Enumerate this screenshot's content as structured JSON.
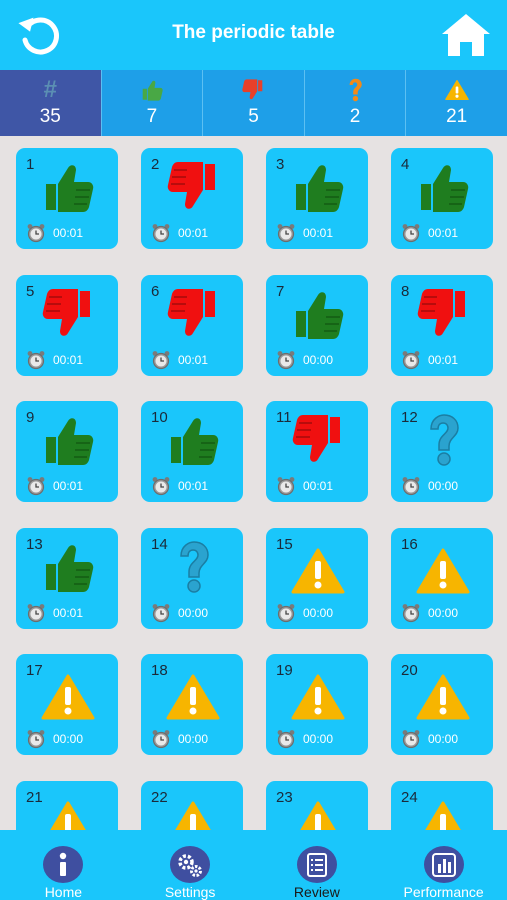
{
  "header": {
    "title": "The periodic table",
    "back_icon": "refresh-back-icon",
    "home_icon": "home-icon"
  },
  "stats": [
    {
      "icon": "hash-icon",
      "symbol": "#",
      "value": "35"
    },
    {
      "icon": "thumbs-up-icon",
      "value": "7"
    },
    {
      "icon": "thumbs-down-icon",
      "value": "5"
    },
    {
      "icon": "question-icon",
      "value": "2"
    },
    {
      "icon": "warning-icon",
      "value": "21"
    }
  ],
  "tiles": [
    {
      "number": "1",
      "status": "correct",
      "time": "00:01"
    },
    {
      "number": "2",
      "status": "wrong",
      "time": "00:01"
    },
    {
      "number": "3",
      "status": "correct",
      "time": "00:01"
    },
    {
      "number": "4",
      "status": "correct",
      "time": "00:01"
    },
    {
      "number": "5",
      "status": "wrong",
      "time": "00:01"
    },
    {
      "number": "6",
      "status": "wrong",
      "time": "00:01"
    },
    {
      "number": "7",
      "status": "correct",
      "time": "00:00"
    },
    {
      "number": "8",
      "status": "wrong",
      "time": "00:01"
    },
    {
      "number": "9",
      "status": "correct",
      "time": "00:01"
    },
    {
      "number": "10",
      "status": "correct",
      "time": "00:01"
    },
    {
      "number": "11",
      "status": "wrong",
      "time": "00:01"
    },
    {
      "number": "12",
      "status": "unsure",
      "time": "00:00"
    },
    {
      "number": "13",
      "status": "correct",
      "time": "00:01"
    },
    {
      "number": "14",
      "status": "unsure",
      "time": "00:00"
    },
    {
      "number": "15",
      "status": "unanswered",
      "time": "00:00"
    },
    {
      "number": "16",
      "status": "unanswered",
      "time": "00:00"
    },
    {
      "number": "17",
      "status": "unanswered",
      "time": "00:00"
    },
    {
      "number": "18",
      "status": "unanswered",
      "time": "00:00"
    },
    {
      "number": "19",
      "status": "unanswered",
      "time": "00:00"
    },
    {
      "number": "20",
      "status": "unanswered",
      "time": "00:00"
    },
    {
      "number": "21",
      "status": "unanswered",
      "time": ""
    },
    {
      "number": "22",
      "status": "unanswered",
      "time": ""
    },
    {
      "number": "23",
      "status": "unanswered",
      "time": ""
    },
    {
      "number": "24",
      "status": "unanswered",
      "time": ""
    }
  ],
  "tabs": [
    {
      "label": "Home",
      "icon": "info-icon"
    },
    {
      "label": "Settings",
      "icon": "gears-icon"
    },
    {
      "label": "Review",
      "icon": "list-icon",
      "active": true
    },
    {
      "label": "Performance",
      "icon": "bar-chart-icon"
    }
  ],
  "colors": {
    "primary": "#1ac6fb",
    "stats_bar": "#1e9fe8",
    "stats_active": "#3f56a6",
    "correct": "#1f7d1f",
    "wrong": "#f01010",
    "unsure": "#2aa3cf",
    "warning": "#f7b500"
  }
}
